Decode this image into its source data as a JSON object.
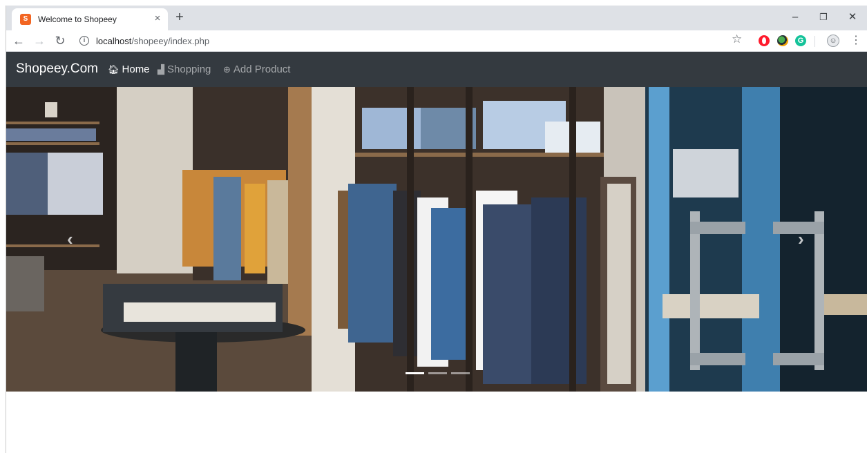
{
  "browser": {
    "tab_title": "Welcome to Shopeey",
    "tab_close": "×",
    "new_tab": "+",
    "url_host": "localhost",
    "url_path": "/shopeey/index.php",
    "window_controls": {
      "minimize": "–",
      "restore": "❐",
      "close": "✕"
    }
  },
  "navbar": {
    "brand": "Shopeey.Com",
    "links": [
      {
        "label": "Home",
        "icon": "home-icon",
        "active": true
      },
      {
        "label": "Shopping",
        "icon": "shopping-bag-icon",
        "active": false
      },
      {
        "label": "Add Product",
        "icon": "plus-circle-icon",
        "active": false
      }
    ]
  },
  "carousel": {
    "prev": "‹",
    "next": "›",
    "slide_count": 3,
    "active_slide": 1
  },
  "colors": {
    "navbar_bg": "#343a40",
    "tabstrip_bg": "#dee1e6",
    "favicon": "#f26522"
  }
}
